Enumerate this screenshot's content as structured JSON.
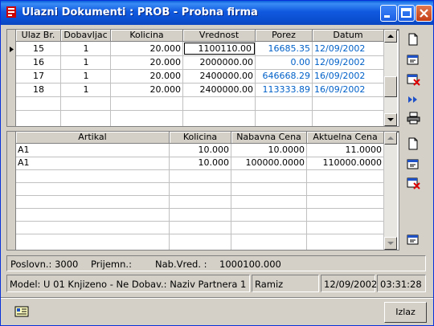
{
  "window": {
    "title": "Ulazni Dokumenti : PROB - Probna firma"
  },
  "documents_table": {
    "columns": [
      "Ulaz Br.",
      "Dobavljac",
      "Kolicina",
      "Vrednost",
      "Porez",
      "Datum"
    ],
    "rows": [
      {
        "ulaz": "15",
        "dobavljac": "1",
        "kolicina": "20.000",
        "vrednost": "1100110.00",
        "porez": "16685.35",
        "datum": "12/09/2002"
      },
      {
        "ulaz": "16",
        "dobavljac": "1",
        "kolicina": "20.000",
        "vrednost": "2000000.00",
        "porez": "0.00",
        "datum": "12/09/2002"
      },
      {
        "ulaz": "17",
        "dobavljac": "1",
        "kolicina": "20.000",
        "vrednost": "2400000.00",
        "porez": "646668.29",
        "datum": "16/09/2002"
      },
      {
        "ulaz": "18",
        "dobavljac": "1",
        "kolicina": "20.000",
        "vrednost": "2400000.00",
        "porez": "113333.89",
        "datum": "16/09/2002"
      }
    ]
  },
  "items_table": {
    "columns": [
      "Artikal",
      "Kolicina",
      "Nabavna Cena",
      "Aktuelna Cena"
    ],
    "rows": [
      {
        "artikal": "A1",
        "kolicina": "10.000",
        "nabavna": "10.0000",
        "aktuelna": "11.0000"
      },
      {
        "artikal": "A1",
        "kolicina": "10.000",
        "nabavna": "100000.0000",
        "aktuelna": "110000.0000"
      }
    ]
  },
  "info_bar": {
    "poslovn": "Poslovn.: 3000",
    "prijemn": "Prijemn.:",
    "nab_vred_label": "Nab.Vred. :",
    "nab_vred_value": "1000100.000"
  },
  "status_bar": {
    "model": "Model:  U 01  Knjizeno - Ne  Dobav.: Naziv Partnera 1",
    "user": "Ramiz",
    "date": "12/09/2002",
    "time": "03:31:28"
  },
  "buttons": {
    "izlaz": "Izlaz"
  },
  "colors": {
    "titlebar": "#0a5fdc",
    "highlight_text": "#0060c8"
  }
}
